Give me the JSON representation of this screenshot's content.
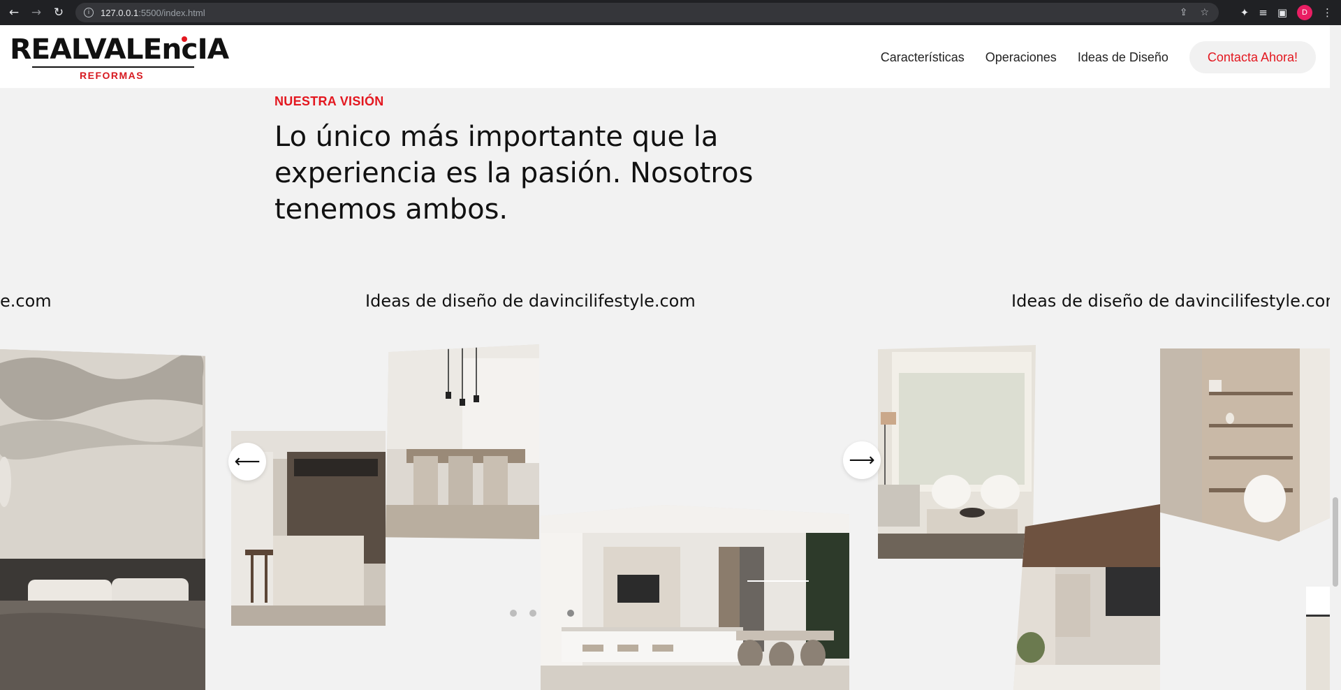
{
  "browser": {
    "url_host": "127.0.0.1",
    "url_path": ":5500/index.html",
    "avatar_initial": "D"
  },
  "header": {
    "logo_text": "REALVALEncIA",
    "logo_sub": "REFORMAS",
    "nav": [
      "Características",
      "Operaciones",
      "Ideas de Diseño"
    ],
    "cta_label": "Contacta Ahora!"
  },
  "vision": {
    "eyebrow": "NUESTRA VISIÓN",
    "headline": "Lo único más importante que la experiencia es la pasión. Nosotros tenemos ambos."
  },
  "carousel": {
    "titles": [
      "e.com",
      "Ideas de diseño de davincilifestyle.com",
      "Ideas de diseño de davincilifestyle.com"
    ],
    "prev_icon": "arrow-left-icon",
    "next_icon": "arrow-right-icon",
    "dots": 3,
    "active_dot": 2
  },
  "colors": {
    "accent": "#e3171f",
    "background": "#f2f2f2",
    "text": "#111111"
  }
}
